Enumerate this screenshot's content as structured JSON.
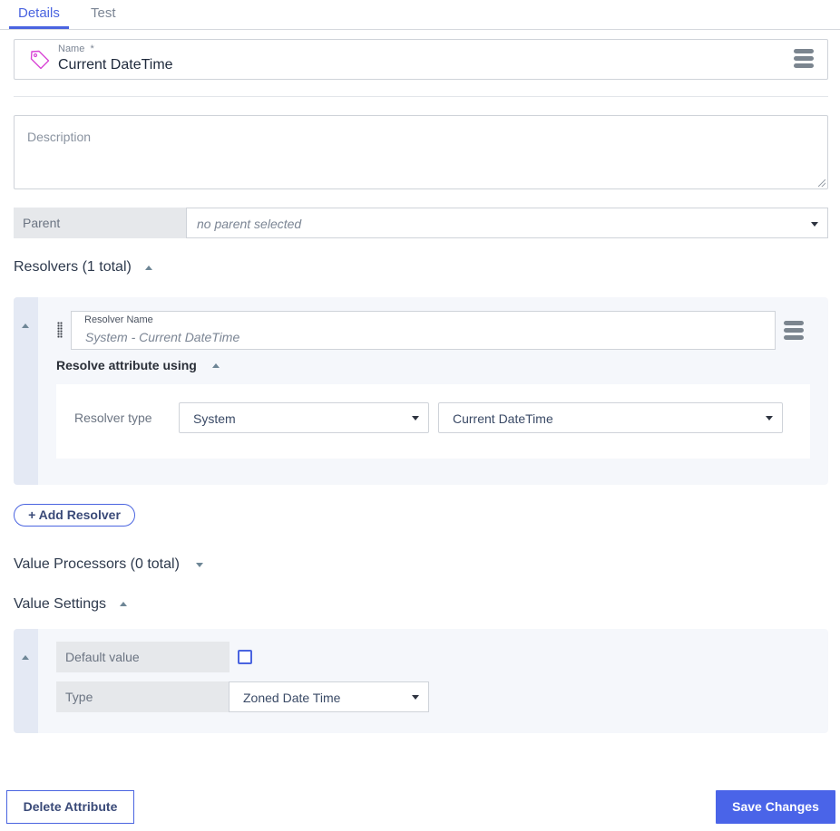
{
  "tabs": [
    {
      "label": "Details",
      "active": true
    },
    {
      "label": "Test",
      "active": false
    }
  ],
  "name_field": {
    "label": "Name",
    "required_marker": "*",
    "value": "Current DateTime",
    "icon": "tag-icon",
    "menu_icon": "hamburger-menu-icon"
  },
  "description": {
    "placeholder": "Description",
    "value": ""
  },
  "parent": {
    "label": "Parent",
    "value": "no parent selected"
  },
  "resolvers_section": {
    "title": "Resolvers (1 total)",
    "expanded": true,
    "resolvers": [
      {
        "name_label": "Resolver Name",
        "name_placeholder": "System - Current DateTime",
        "resolve_title": "Resolve attribute using",
        "resolver_type_label": "Resolver type",
        "resolver_type_value": "System",
        "resolver_value": "Current DateTime"
      }
    ],
    "add_button": "+ Add Resolver"
  },
  "value_processors_section": {
    "title": "Value Processors (0 total)",
    "expanded": false
  },
  "value_settings_section": {
    "title": "Value Settings",
    "expanded": true,
    "default_value_label": "Default value",
    "default_value_checked": false,
    "type_label": "Type",
    "type_value": "Zoned Date Time"
  },
  "footer": {
    "delete_label": "Delete Attribute",
    "save_label": "Save Changes"
  },
  "colors": {
    "accent": "#4a64e0",
    "save_button": "#4a64e8",
    "tag_icon": "#d946d6"
  }
}
